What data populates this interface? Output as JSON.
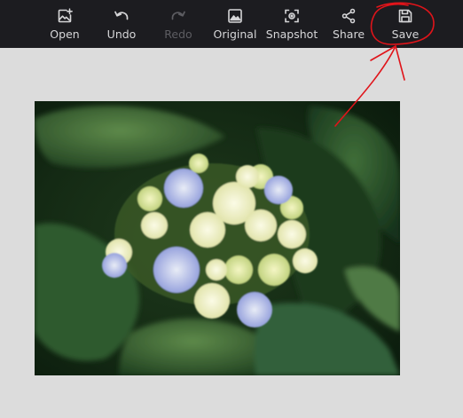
{
  "toolbar": {
    "open_label": "Open",
    "undo_label": "Undo",
    "redo_label": "Redo",
    "original_label": "Original",
    "snapshot_label": "Snapshot",
    "share_label": "Share",
    "save_label": "Save"
  },
  "colors": {
    "toolbar_bg": "#1c1c20",
    "toolbar_text": "#d6d6d8",
    "disabled_text": "#5d5d62",
    "canvas_bg": "#dcdcdc",
    "annotation_red": "#e0141a"
  },
  "image": {
    "subject": "blue and cream hydrangea flower cluster on dark green leaves"
  }
}
